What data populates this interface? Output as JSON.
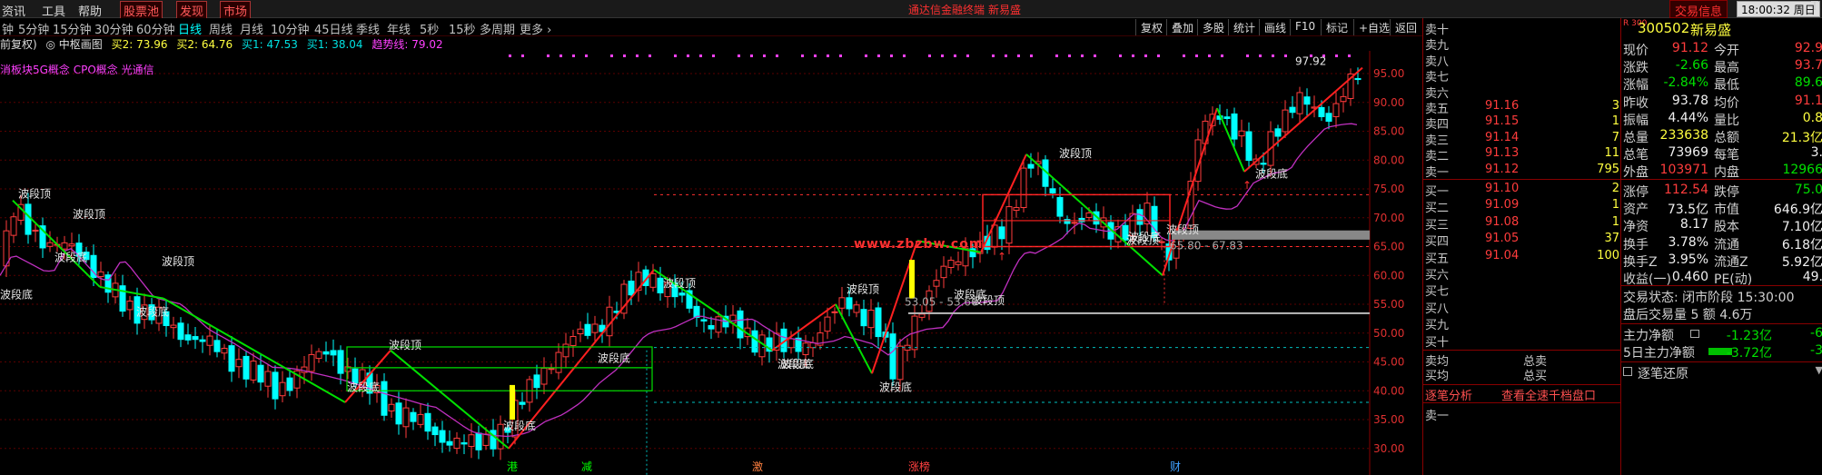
{
  "menubar": {
    "items": [
      "资讯",
      "工具",
      "帮助",
      "股票池",
      "发现",
      "市场"
    ],
    "news1": "通达信金融终端",
    "news2": "新易盛",
    "brand": "交易信息",
    "clock": "18:00:32 周日",
    "logo": "T"
  },
  "periodbar": {
    "items": [
      "钟",
      "5分钟",
      "15分钟",
      "30分钟",
      "60分钟",
      "日线",
      "周线",
      "月线",
      "10分钟",
      "45日线",
      "季线",
      "年线",
      "5秒",
      "15秒",
      "多周期",
      "更多 ›"
    ],
    "active": "日线",
    "tools": [
      "复权",
      "叠加",
      "多股",
      "统计",
      "画线",
      "F10",
      "标记",
      "+自选",
      "返回"
    ]
  },
  "indicator": {
    "title": "前复权)",
    "name": "◎ 中枢画图",
    "items": [
      {
        "label": "买2: 73.96",
        "color": "#ffff40"
      },
      {
        "label": "买2: 64.76",
        "color": "#ffff40"
      },
      {
        "label": "买1: 47.53",
        "color": "#00e0e0"
      },
      {
        "label": "买1: 38.04",
        "color": "#00e0e0"
      },
      {
        "label": "趋势线: 79.02",
        "color": "#ff40ff"
      }
    ],
    "concept": "消板块5G概念 CPO概念 光通信"
  },
  "chart": {
    "axis_ticks": [
      "95.00",
      "90.00",
      "85.00",
      "80.00",
      "75.00",
      "70.00",
      "65.00",
      "60.00",
      "55.00",
      "50.00",
      "45.00",
      "40.00",
      "35.00",
      "30.00"
    ],
    "wave_labels": [
      "波段顶",
      "波段顶",
      "波段底",
      "波段顶",
      "波段底",
      "波段底",
      "波段顶",
      "波段底",
      "波段底",
      "波段顶",
      "波段底",
      "波段顶",
      "波段底",
      "波段顶",
      "波段底",
      "波段顶",
      "波段底",
      "波段顶",
      "波段底",
      "波段底",
      "波段顶",
      "波段底"
    ],
    "price_notes": [
      "97.92",
      "65.80 - 67.83",
      "53.05 - 53.66"
    ],
    "watermark": "www.zbzbw.com",
    "events": [
      {
        "text": "港",
        "color": "#00ff00"
      },
      {
        "text": "减",
        "color": "#00ff00"
      },
      {
        "text": "激",
        "color": "#ff8040"
      },
      {
        "text": "涨榜",
        "color": "#ff4040"
      },
      {
        "text": "财",
        "color": "#40a0ff"
      }
    ],
    "colors": {
      "up": "#ff3c3c",
      "down": "#00ffff",
      "ma": "#c030c0",
      "wave_up": "#ff2020",
      "wave_down": "#00e000"
    }
  },
  "orderbook": {
    "sell": [
      {
        "label": "卖十",
        "price": "",
        "vol": ""
      },
      {
        "label": "卖九",
        "price": "",
        "vol": ""
      },
      {
        "label": "卖八",
        "price": "",
        "vol": ""
      },
      {
        "label": "卖七",
        "price": "",
        "vol": ""
      },
      {
        "label": "卖六",
        "price": "",
        "vol": ""
      },
      {
        "label": "卖五",
        "price": "91.16",
        "vol": "3"
      },
      {
        "label": "卖四",
        "price": "91.15",
        "vol": "1"
      },
      {
        "label": "卖三",
        "price": "91.14",
        "vol": "7"
      },
      {
        "label": "卖二",
        "price": "91.13",
        "vol": "11"
      },
      {
        "label": "卖一",
        "price": "91.12",
        "vol": "795"
      }
    ],
    "buy": [
      {
        "label": "买一",
        "price": "91.10",
        "vol": "2"
      },
      {
        "label": "买二",
        "price": "91.09",
        "vol": "1"
      },
      {
        "label": "买三",
        "price": "91.08",
        "vol": "1"
      },
      {
        "label": "买四",
        "price": "91.05",
        "vol": "37"
      },
      {
        "label": "买五",
        "price": "91.04",
        "vol": "100"
      },
      {
        "label": "买六",
        "price": "",
        "vol": ""
      },
      {
        "label": "买七",
        "price": "",
        "vol": ""
      },
      {
        "label": "买八",
        "price": "",
        "vol": ""
      },
      {
        "label": "买九",
        "price": "",
        "vol": ""
      },
      {
        "label": "买十",
        "price": "",
        "vol": ""
      }
    ],
    "avg_sell": "卖均",
    "avg_buy": "买均",
    "total_sell": "总卖",
    "total_buy": "总买",
    "tick_analysis": "逐笔分析",
    "full_depth": "查看全速千档盘口",
    "sell_one": "卖一"
  },
  "quote": {
    "code": "300502",
    "name": "新易盛",
    "tag": "R 300",
    "rows": [
      {
        "l": "现价",
        "v": "91.12",
        "vc": "red",
        "l2": "今开",
        "v2": "92.9",
        "v2c": "red"
      },
      {
        "l": "涨跌",
        "v": "-2.66",
        "vc": "green",
        "l2": "最高",
        "v2": "93.7",
        "v2c": "red"
      },
      {
        "l": "涨幅",
        "v": "-2.84%",
        "vc": "green",
        "l2": "最低",
        "v2": "89.6",
        "v2c": "green"
      },
      {
        "l": "昨收",
        "v": "93.78",
        "vc": "white",
        "l2": "均价",
        "v2": "91.1",
        "v2c": "red"
      },
      {
        "l": "振幅",
        "v": "4.44%",
        "vc": "white",
        "l2": "量比",
        "v2": "0.8",
        "v2c": "yellow"
      },
      {
        "l": "总量",
        "v": "233638",
        "vc": "yellow",
        "l2": "总额",
        "v2": "21.3亿",
        "v2c": "yellow"
      },
      {
        "l": "总笔",
        "v": "73969",
        "vc": "white",
        "l2": "每笔",
        "v2": "3.",
        "v2c": "white"
      },
      {
        "l": "外盘",
        "v": "103971",
        "vc": "red",
        "l2": "内盘",
        "v2": "12966",
        "v2c": "green"
      }
    ],
    "rows2": [
      {
        "l": "涨停",
        "v": "112.54",
        "vc": "red",
        "l2": "跌停",
        "v2": "75.0",
        "v2c": "green"
      },
      {
        "l": "资产",
        "v": "73.5亿",
        "vc": "white",
        "l2": "市值",
        "v2": "646.9亿",
        "v2c": "white"
      },
      {
        "l": "净资",
        "v": "8.17",
        "vc": "white",
        "l2": "股本",
        "v2": "7.10亿",
        "v2c": "white"
      },
      {
        "l": "换手",
        "v": "3.78%",
        "vc": "white",
        "l2": "流通",
        "v2": "6.18亿",
        "v2c": "white"
      },
      {
        "l": "换手Z",
        "v": "3.95%",
        "vc": "white",
        "l2": "流通Z",
        "v2": "5.92亿",
        "v2c": "white"
      },
      {
        "l": "收益(一)",
        "v": "0.460",
        "vc": "white",
        "l2": "PE(动)",
        "v2": "49.",
        "v2c": "white"
      }
    ],
    "trade_state": "交易状态: 闭市阶段 15:30:00",
    "after_hours": "盘后交易量 5 额 4.6万",
    "main_net": {
      "label": "主力净额",
      "value": "-1.23亿",
      "extra": "-6"
    },
    "main_net5": {
      "label": "5日主力净额",
      "value": "-3.72亿",
      "extra": "-3"
    },
    "tick_restore": "逐笔还原",
    "tick_restore_mark": "▼"
  }
}
